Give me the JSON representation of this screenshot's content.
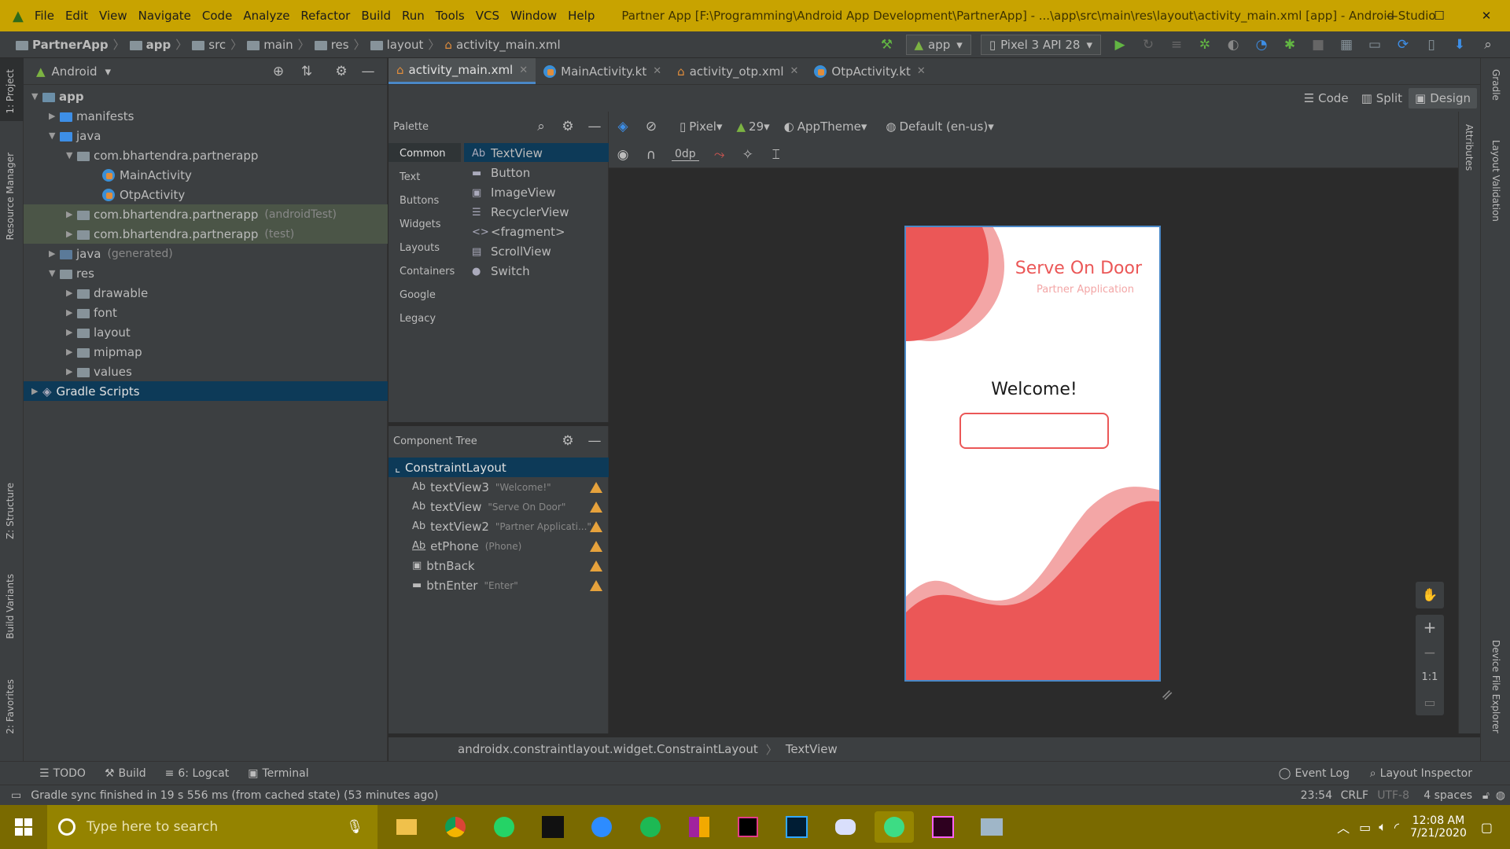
{
  "window": {
    "menu": [
      "File",
      "Edit",
      "View",
      "Navigate",
      "Code",
      "Analyze",
      "Refactor",
      "Build",
      "Run",
      "Tools",
      "VCS",
      "Window",
      "Help"
    ],
    "title": "Partner App [F:\\Programming\\Android App Development\\PartnerApp] - ...\\app\\src\\main\\res\\layout\\activity_main.xml [app] - Android Studio",
    "controls": {
      "minimize": "—",
      "maximize": "☐",
      "close": "✕"
    }
  },
  "navbar": {
    "breadcrumb": [
      "PartnerApp",
      "app",
      "src",
      "main",
      "res",
      "layout",
      "activity_main.xml"
    ],
    "run_config": "app",
    "device": "Pixel 3 API 28"
  },
  "left_stripe": {
    "project": "1: Project",
    "resource_manager": "Resource Manager",
    "structure": "Z: Structure",
    "build_variants": "Build Variants",
    "favorites": "2: Favorites"
  },
  "right_stripe": {
    "gradle": "Gradle",
    "layout_validation": "Layout Validation",
    "attributes": "Attributes",
    "device_file_explorer": "Device File Explorer"
  },
  "project": {
    "view": "Android",
    "tree": [
      {
        "label": "app",
        "hint": ""
      },
      {
        "label": "manifests",
        "hint": ""
      },
      {
        "label": "java",
        "hint": ""
      },
      {
        "label": "com.bhartendra.partnerapp",
        "hint": ""
      },
      {
        "label": "MainActivity",
        "hint": ""
      },
      {
        "label": "OtpActivity",
        "hint": ""
      },
      {
        "label": "com.bhartendra.partnerapp",
        "hint": "(androidTest)"
      },
      {
        "label": "com.bhartendra.partnerapp",
        "hint": "(test)"
      },
      {
        "label": "java",
        "hint": "(generated)"
      },
      {
        "label": "res",
        "hint": ""
      },
      {
        "label": "drawable",
        "hint": ""
      },
      {
        "label": "font",
        "hint": ""
      },
      {
        "label": "layout",
        "hint": ""
      },
      {
        "label": "mipmap",
        "hint": ""
      },
      {
        "label": "values",
        "hint": ""
      },
      {
        "label": "Gradle Scripts",
        "hint": ""
      }
    ]
  },
  "tabs": [
    {
      "label": "activity_main.xml"
    },
    {
      "label": "MainActivity.kt"
    },
    {
      "label": "activity_otp.xml"
    },
    {
      "label": "OtpActivity.kt"
    }
  ],
  "modes": {
    "code": "Code",
    "split": "Split",
    "design": "Design"
  },
  "palette": {
    "title": "Palette",
    "categories": [
      "Common",
      "Text",
      "Buttons",
      "Widgets",
      "Layouts",
      "Containers",
      "Google",
      "Legacy"
    ],
    "items": [
      {
        "icon": "Ab",
        "label": "TextView"
      },
      {
        "icon": "▬",
        "label": "Button"
      },
      {
        "icon": "▣",
        "label": "ImageView"
      },
      {
        "icon": "☰",
        "label": "RecyclerView"
      },
      {
        "icon": "<>",
        "label": "<fragment>"
      },
      {
        "icon": "▤",
        "label": "ScrollView"
      },
      {
        "icon": "●",
        "label": "Switch"
      }
    ]
  },
  "design_toolbar": {
    "device": "Pixel",
    "api": "29",
    "theme": "AppTheme",
    "locale": "Default (en-us)",
    "margin": "0dp"
  },
  "component_tree": {
    "title": "Component Tree",
    "root": "ConstraintLayout",
    "items": [
      {
        "icon": "Ab",
        "id": "textView3",
        "hint": "\"Welcome!\""
      },
      {
        "icon": "Ab",
        "id": "textView",
        "hint": "\"Serve On Door\""
      },
      {
        "icon": "Ab",
        "id": "textView2",
        "hint": "\"Partner Applicati...\""
      },
      {
        "icon": "Ab",
        "id": "etPhone",
        "hint": "(Phone)"
      },
      {
        "icon": "▣",
        "id": "btnBack",
        "hint": ""
      },
      {
        "icon": "▬",
        "id": "btnEnter",
        "hint": "\"Enter\""
      }
    ]
  },
  "preview": {
    "title": "Serve On Door",
    "subtitle": "Partner Application",
    "welcome": "Welcome!",
    "accent": "#eb5757",
    "accent_light": "#f3a6a6"
  },
  "zoom": {
    "ratio": "1:1"
  },
  "crumbbar": [
    "androidx.constraintlayout.widget.ConstraintLayout",
    "TextView"
  ],
  "toolwindows": {
    "todo": "TODO",
    "build": "Build",
    "logcat": "6: Logcat",
    "terminal": "Terminal",
    "event_log": "Event Log",
    "layout_inspector": "Layout Inspector"
  },
  "status": {
    "message": "Gradle sync finished in 19 s 556 ms (from cached state) (53 minutes ago)",
    "position": "23:54",
    "line_sep": "CRLF",
    "encoding": "UTF-8",
    "indent": "4 spaces"
  },
  "taskbar": {
    "search_placeholder": "Type here to search",
    "time": "12:08 AM",
    "date": "7/21/2020"
  }
}
